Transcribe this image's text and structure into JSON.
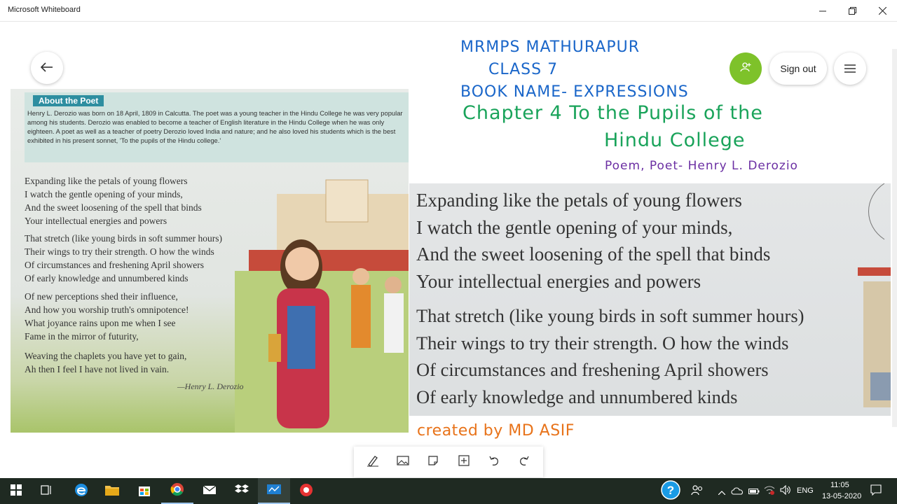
{
  "window": {
    "title": "Microsoft Whiteboard"
  },
  "header": {
    "sign_out_label": "Sign out"
  },
  "board": {
    "line1": "MRMPS MATHURAPUR",
    "line2": "CLASS 7",
    "line3": "BOOK NAME- EXPRESSIONS",
    "line4": "Chapter 4   To the Pupils of the",
    "line5": "Hindu College",
    "line6": "Poem, Poet- Henry L. Derozio",
    "credit": "created by MD ASIF",
    "colors": {
      "blue": "#1a66c9",
      "green": "#19a35a",
      "purple": "#6b2fa3",
      "orange": "#e8731a"
    }
  },
  "book_page": {
    "heading": "About the Poet",
    "about_text": "Henry L. Derozio was born on 18 April, 1809 in Calcutta. The poet was a young teacher in the Hindu College he was very popular among his students. Derozio was enabled to become a teacher of English literature in the Hindu College when he was only eighteen. A poet as well as a teacher of poetry Derozio loved India and nature; and he also loved his students which is the best exhibited in his present sonnet, 'To the pupils of the Hindu college.'",
    "stanzas": [
      [
        "Expanding like the petals of young flowers",
        "I watch the gentle opening of your minds,",
        "And the sweet loosening of the spell that binds",
        "Your intellectual energies and powers"
      ],
      [
        "That stretch (like young birds in soft summer hours)",
        "Their wings to try their strength. O how the winds",
        "Of circumstances and freshening April showers",
        "Of early knowledge and unnumbered kinds"
      ],
      [
        "Of new perceptions shed their influence,",
        "And how you worship truth's omnipotence!",
        "What joyance rains upon me when I see",
        "Fame in the mirror of futurity,"
      ],
      [
        "Weaving the chaplets you have yet to gain,",
        "Ah then I feel I have not lived in vain."
      ]
    ],
    "author": "—Henry L. Derozio"
  },
  "zoomed_page": {
    "stanza1": [
      "Expanding like the petals of young flowers",
      "I watch the gentle opening of your minds,",
      "And the sweet loosening of the spell that binds",
      "Your intellectual energies and powers"
    ],
    "stanza2": [
      "That stretch (like young birds in soft summer hours)",
      "Their wings to try their strength. O how the winds",
      "Of circumstances and freshening April showers",
      "Of early knowledge and unnumbered kinds"
    ]
  },
  "toolbar": {
    "tools": [
      "pen-icon",
      "image-icon",
      "note-icon",
      "add-icon",
      "undo-icon",
      "redo-icon"
    ]
  },
  "taskbar": {
    "language": "ENG",
    "time": "11:05",
    "date": "13-05-2020"
  }
}
